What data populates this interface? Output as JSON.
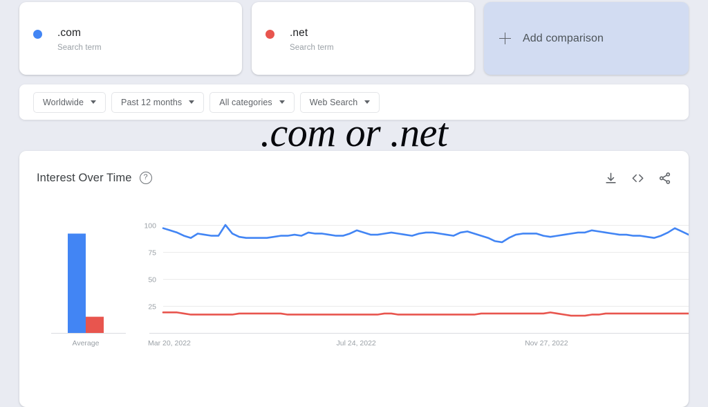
{
  "search_terms": [
    {
      "label": ".com",
      "sublabel": "Search term",
      "color": "#4285f4",
      "dot": "blue-dot"
    },
    {
      "label": ".net",
      "sublabel": "Search term",
      "color": "#e8554e",
      "dot": "red-dot"
    }
  ],
  "add_comparison": {
    "label": "Add comparison",
    "icon": "plus-icon"
  },
  "filters": [
    {
      "label": "Worldwide"
    },
    {
      "label": "Past 12 months"
    },
    {
      "label": "All categories"
    },
    {
      "label": "Web Search"
    }
  ],
  "overlay_title": ".com or .net",
  "chart_card": {
    "title": "Interest Over Time",
    "help_glyph": "?",
    "actions": [
      {
        "name": "download-icon"
      },
      {
        "name": "embed-code-icon"
      },
      {
        "name": "share-icon"
      }
    ]
  },
  "chart_data": [
    {
      "type": "bar",
      "title": "Average",
      "categories": [
        "Average"
      ],
      "series": [
        {
          "name": ".com",
          "values": [
            92
          ],
          "color": "#4285f4"
        },
        {
          "name": ".net",
          "values": [
            15
          ],
          "color": "#e8554e"
        }
      ],
      "xlabel": "",
      "ylabel": "",
      "ylim": [
        0,
        100
      ],
      "grid": false,
      "legend": "none",
      "axis_label": "Average"
    },
    {
      "type": "line",
      "title": "Interest Over Time",
      "xlabel": "",
      "ylabel": "",
      "ylim": [
        0,
        100
      ],
      "yticks": [
        25,
        50,
        75,
        100
      ],
      "ytick_labels": [
        "25",
        "50",
        "75",
        "100"
      ],
      "xtick_labels": [
        "Mar 20, 2022",
        "Jul 24, 2022",
        "Nov 27, 2022"
      ],
      "xtick_positions": [
        0,
        0.345,
        0.69
      ],
      "grid": true,
      "legend": "none",
      "series": [
        {
          "name": ".com",
          "color": "#4285f4",
          "values": [
            97,
            95,
            93,
            90,
            88,
            92,
            91,
            90,
            90,
            100,
            92,
            89,
            88,
            88,
            88,
            88,
            89,
            90,
            90,
            91,
            90,
            93,
            92,
            92,
            91,
            90,
            90,
            92,
            95,
            93,
            91,
            91,
            92,
            93,
            92,
            91,
            90,
            92,
            93,
            93,
            92,
            91,
            90,
            93,
            94,
            92,
            90,
            88,
            85,
            84,
            88,
            91,
            92,
            92,
            92,
            90,
            89,
            90,
            91,
            92,
            93,
            93,
            95,
            94,
            93,
            92,
            91,
            91,
            90,
            90,
            89,
            88,
            90,
            93,
            97,
            94,
            91,
            91,
            92,
            91
          ]
        },
        {
          "name": ".net",
          "color": "#e8554e",
          "values": [
            19,
            19,
            19,
            18,
            17,
            17,
            17,
            17,
            17,
            17,
            17,
            18,
            18,
            18,
            18,
            18,
            18,
            18,
            17,
            17,
            17,
            17,
            17,
            17,
            17,
            17,
            17,
            17,
            17,
            17,
            17,
            17,
            18,
            18,
            17,
            17,
            17,
            17,
            17,
            17,
            17,
            17,
            17,
            17,
            17,
            17,
            18,
            18,
            18,
            18,
            18,
            18,
            18,
            18,
            18,
            18,
            19,
            18,
            17,
            16,
            16,
            16,
            17,
            17,
            18,
            18,
            18,
            18,
            18,
            18,
            18,
            18,
            18,
            18,
            18,
            18,
            18,
            18,
            18,
            18
          ]
        }
      ]
    }
  ]
}
